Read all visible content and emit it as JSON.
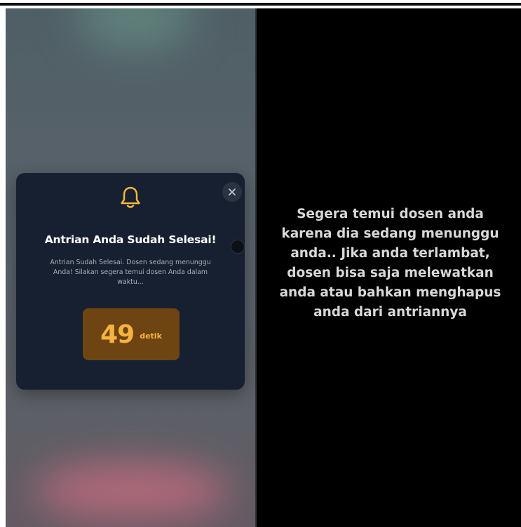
{
  "modal": {
    "icon": "bell-icon",
    "close_icon": "close-icon",
    "close_glyph": "✕",
    "title": "Antrian Anda Sudah Selesai!",
    "description": "Antrian Sudah Selesai. Dosen sedang menunggu Anda! Silakan segera temui dosen Anda dalam waktu...",
    "countdown_value": "49",
    "countdown_unit": "detik"
  },
  "caption": {
    "lines": [
      "Segera temui dosen anda",
      "karena dia sedang menunggu",
      "anda.. Jika anda terlambat,",
      "dosen bisa saja melewatkan",
      "anda atau bahkan menghapus",
      "anda dari antriannya"
    ]
  },
  "colors": {
    "modal_bg": "#172030",
    "accent": "#f7b33f",
    "timer_bg": "#6f4413",
    "caption_text": "#d8d8d8"
  }
}
